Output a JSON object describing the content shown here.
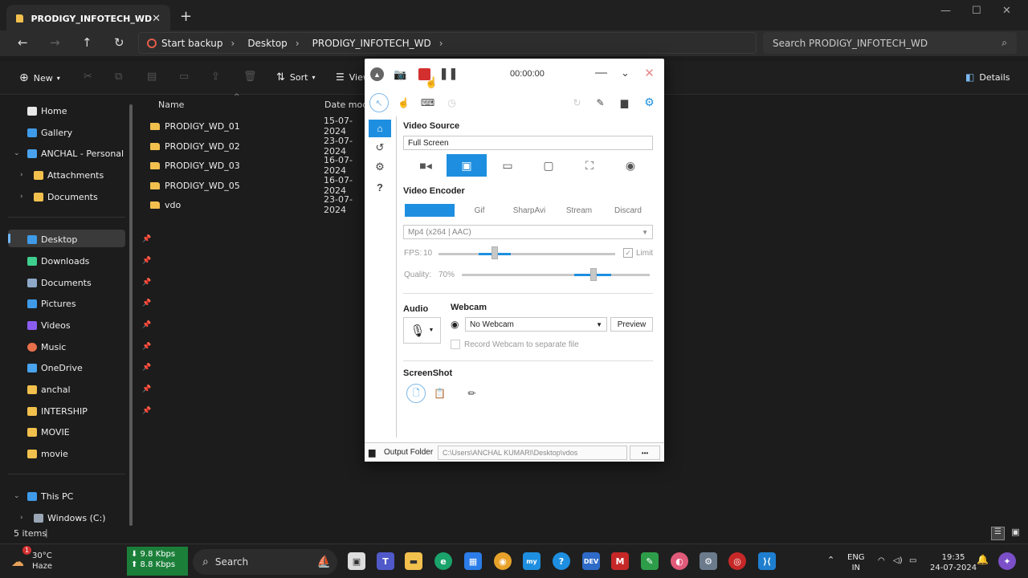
{
  "window": {
    "tab_title": "PRODIGY_INFOTECH_WD",
    "close_tab": "✕",
    "new_tab": "+"
  },
  "address": {
    "backup_label": "Start backup",
    "crumbs": [
      "Desktop",
      "PRODIGY_INFOTECH_WD"
    ],
    "search_placeholder": "Search PRODIGY_INFOTECH_WD"
  },
  "toolbar": {
    "new_label": "New",
    "sort_label": "Sort",
    "view_label": "View",
    "details_label": "Details"
  },
  "sidebar": {
    "items": [
      {
        "label": "Home"
      },
      {
        "label": "Gallery"
      },
      {
        "label": "ANCHAL - Personal"
      },
      {
        "label": "Attachments"
      },
      {
        "label": "Documents"
      },
      {
        "label": "Desktop"
      },
      {
        "label": "Downloads"
      },
      {
        "label": "Documents"
      },
      {
        "label": "Pictures"
      },
      {
        "label": "Videos"
      },
      {
        "label": "Music"
      },
      {
        "label": "OneDrive"
      },
      {
        "label": "anchal"
      },
      {
        "label": "INTERSHIP"
      },
      {
        "label": "MOVIE"
      },
      {
        "label": "movie"
      },
      {
        "label": "This PC"
      },
      {
        "label": "Windows (C:)"
      }
    ]
  },
  "files": {
    "col_name": "Name",
    "col_date": "Date modi",
    "rows": [
      {
        "name": "PRODIGY_WD_01",
        "date": "15-07-2024"
      },
      {
        "name": "PRODIGY_WD_02",
        "date": "23-07-2024"
      },
      {
        "name": "PRODIGY_WD_03",
        "date": "16-07-2024"
      },
      {
        "name": "PRODIGY_WD_05",
        "date": "16-07-2024"
      },
      {
        "name": "vdo",
        "date": "23-07-2024"
      }
    ]
  },
  "status": {
    "items_count": "5 items"
  },
  "recorder": {
    "timer": "00:00:00",
    "video_source_title": "Video Source",
    "video_source_value": "Full Screen",
    "video_encoder_title": "Video Encoder",
    "encoder_tabs": [
      "Gif",
      "SharpAvi",
      "Stream",
      "Discard"
    ],
    "codec": "Mp4 (x264 | AAC)",
    "fps_label": "FPS:",
    "fps_value": "10",
    "fps_fraction": 0.18,
    "limit_label": "Limit",
    "quality_label": "Quality:",
    "quality_value": "70%",
    "quality_fraction": 0.7,
    "audio_title": "Audio",
    "webcam_title": "Webcam",
    "webcam_value": "No Webcam",
    "preview_label": "Preview",
    "record_webcam_label": "Record Webcam to separate file",
    "screenshot_title": "ScreenShot",
    "output_folder_label": "Output Folder",
    "output_path": "C:\\Users\\ANCHAL KUMARI\\Desktop\\vdos",
    "more_label": "•••",
    "accent_color": "#1e8fe0",
    "record_color": "#d32f2f"
  },
  "taskbar": {
    "weather_temp": "30°C",
    "weather_desc": "Haze",
    "net_down": "⬇ 9.8 Kbps",
    "net_up": "⬆ 8.8 Kbps",
    "search_label": "Search",
    "lang_top": "ENG",
    "lang_bottom": "IN",
    "time": "19:35",
    "date": "24-07-2024",
    "notif_badge": "1"
  }
}
